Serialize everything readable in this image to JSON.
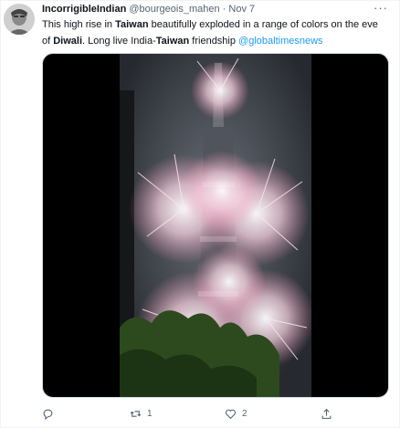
{
  "tweet": {
    "display_name": "IncorrigibleIndian",
    "handle": "@bourgeois_mahen",
    "separator": "·",
    "date": "Nov 7",
    "more_label": "···",
    "text_parts": {
      "p1": "This high rise in ",
      "b1": "Taiwan",
      "p2": " beautifully exploded in a range of colors on the eve of ",
      "b2": "Diwali",
      "p3": ". Long live India-",
      "b3": "Taiwan",
      "p4": " friendship ",
      "mention": "@globaltimesnews"
    }
  },
  "actions": {
    "reply_count": "",
    "retweet_count": "1",
    "like_count": "2"
  },
  "colors": {
    "accent": "#1d9bf0",
    "text": "#0f1419",
    "muted": "#536471"
  },
  "icons": [
    "reply-icon",
    "retweet-icon",
    "like-icon",
    "share-icon",
    "more-icon"
  ]
}
